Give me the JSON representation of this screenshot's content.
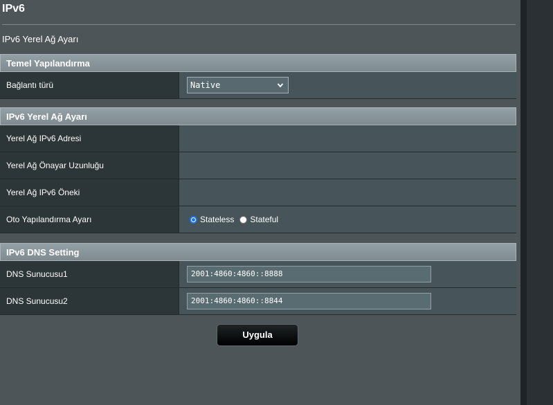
{
  "page": {
    "title": "IPv6",
    "subtitle": "IPv6 Yerel Ağ Ayarı"
  },
  "basic_config": {
    "header": "Temel Yapılandırma",
    "connection_type": {
      "label": "Bağlantı türü",
      "value": "Native"
    }
  },
  "lan_settings": {
    "header": "IPv6 Yerel Ağ Ayarı",
    "lan_ipv6_address": {
      "label": "Yerel Ağ IPv6 Adresi",
      "value": ""
    },
    "lan_prefix_length": {
      "label": "Yerel Ağ Önayar Uzunluğu",
      "value": ""
    },
    "lan_ipv6_prefix": {
      "label": "Yerel Ağ IPv6 Öneki",
      "value": ""
    },
    "auto_config": {
      "label": "Oto Yapılandırma Ayarı",
      "options": [
        "Stateless",
        "Stateful"
      ],
      "selected": "Stateless"
    }
  },
  "dns_settings": {
    "header": "IPv6 DNS Setting",
    "dns1": {
      "label": "DNS Sunucusu1",
      "value": "2001:4860:4860::8888"
    },
    "dns2": {
      "label": "DNS Sunucusu2",
      "value": "2001:4860:4860::8844"
    }
  },
  "actions": {
    "apply_label": "Uygula"
  },
  "icons": {
    "select_arrow": "chevron-down-icon"
  },
  "colors": {
    "accent": "#1a73e8",
    "section_header": "#8a979c"
  }
}
